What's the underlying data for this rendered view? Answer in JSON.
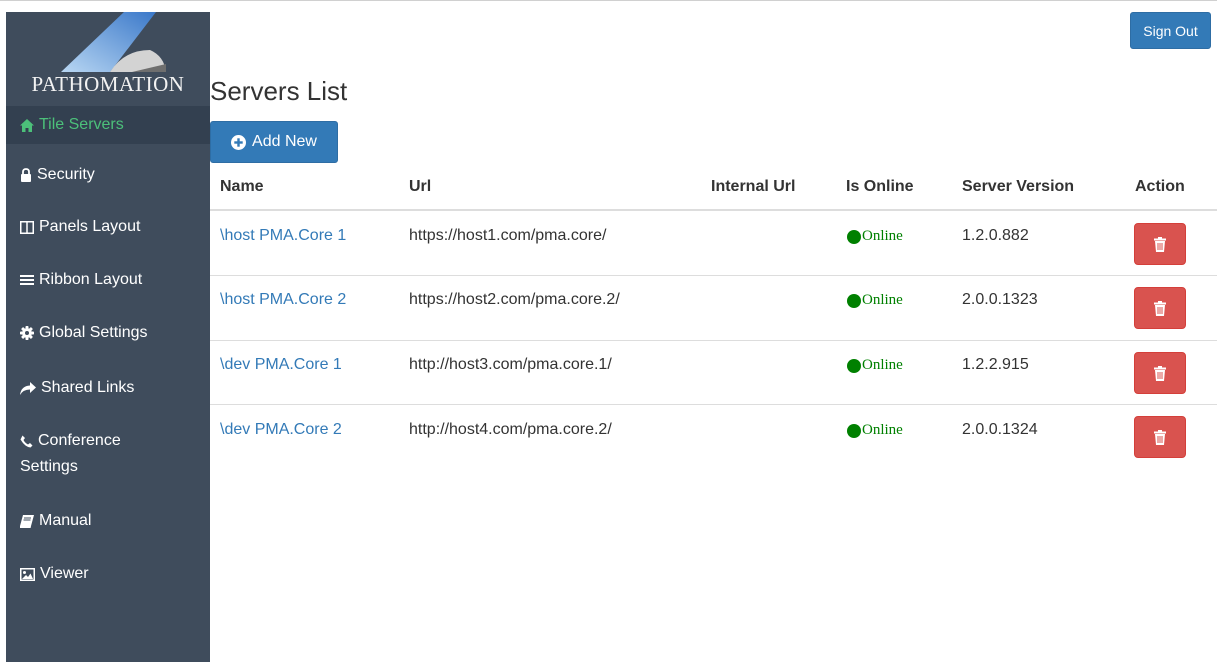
{
  "app": {
    "logo_text": "PATHOMATION",
    "colors": {
      "sidebar_bg": "#3f4c5c",
      "sidebar_active_bg": "#334050",
      "active_text": "#4cc07a",
      "primary": "#337ab7",
      "danger": "#d9534f",
      "online": "#008000"
    }
  },
  "sidebar": {
    "items": [
      {
        "label": "Tile Servers",
        "icon": "home-icon",
        "active": true
      },
      {
        "label": "Security",
        "icon": "lock-icon"
      },
      {
        "label": "Panels Layout",
        "icon": "columns-icon"
      },
      {
        "label": "Ribbon Layout",
        "icon": "menu-bars-icon"
      },
      {
        "label": "Global Settings",
        "icon": "gear-icon"
      },
      {
        "label": "Shared Links",
        "icon": "share-arrow-icon"
      },
      {
        "label": "Conference",
        "label2": "Settings",
        "icon": "phone-icon"
      },
      {
        "label": "Manual",
        "icon": "book-icon"
      },
      {
        "label": "Viewer",
        "icon": "image-icon"
      }
    ]
  },
  "header": {
    "sign_out_label": "Sign Out"
  },
  "main": {
    "title": "Servers List",
    "add_new_label": "Add New",
    "columns": [
      "Name",
      "Url",
      "Internal Url",
      "Is Online",
      "Server Version",
      "Action"
    ],
    "rows": [
      {
        "name": "\\host PMA.Core 1",
        "url": "https://host1.com/pma.core/",
        "internal_url": "",
        "status": "Online",
        "version": "1.2.0.882"
      },
      {
        "name": "\\host PMA.Core 2",
        "url": "https://host2.com/pma.core.2/",
        "internal_url": "",
        "status": "Online",
        "version": "2.0.0.1323"
      },
      {
        "name": "\\dev PMA.Core 1",
        "url": "http://host3.com/pma.core.1/",
        "internal_url": "",
        "status": "Online",
        "version": "1.2.2.915"
      },
      {
        "name": "\\dev PMA.Core 2",
        "url": "http://host4.com/pma.core.2/",
        "internal_url": "",
        "status": "Online",
        "version": "2.0.0.1324"
      }
    ]
  }
}
